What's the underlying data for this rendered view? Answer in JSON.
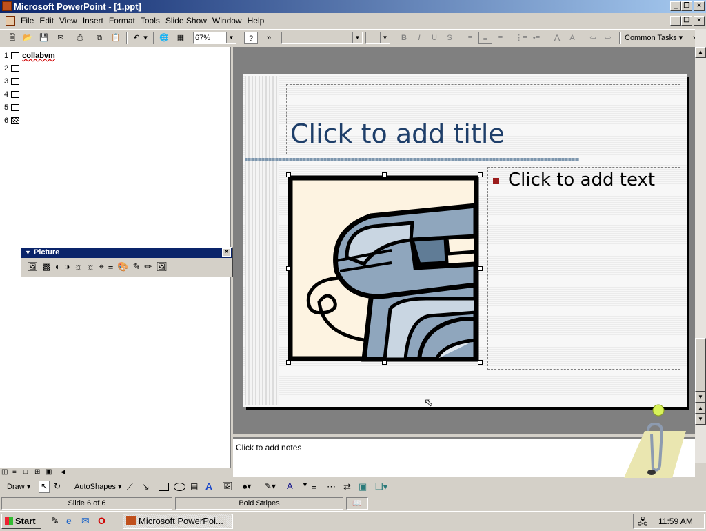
{
  "window": {
    "title": "Microsoft PowerPoint - [1.ppt]"
  },
  "menu": [
    "File",
    "Edit",
    "View",
    "Insert",
    "Format",
    "Tools",
    "Slide Show",
    "Window",
    "Help"
  ],
  "toolbar": {
    "zoom": "67%",
    "common_tasks": "Common Tasks ▾",
    "font_name": "",
    "font_size": ""
  },
  "outline": {
    "slides": [
      {
        "num": "1",
        "text": "collabvm"
      },
      {
        "num": "2",
        "text": ""
      },
      {
        "num": "3",
        "text": ""
      },
      {
        "num": "4",
        "text": ""
      },
      {
        "num": "5",
        "text": ""
      },
      {
        "num": "6",
        "text": ""
      }
    ]
  },
  "picture_toolbar": {
    "title": "Picture"
  },
  "slide": {
    "title_placeholder": "Click to add title",
    "text_placeholder": "Click to add text",
    "accent_color": "#9b1c1c",
    "title_color": "#1f3f6a"
  },
  "notes": {
    "placeholder": "Click to add notes"
  },
  "drawing": {
    "draw_label": "Draw ▾",
    "autoshapes_label": "AutoShapes ▾"
  },
  "status": {
    "slide": "Slide 6 of 6",
    "design": "Bold Stripes"
  },
  "taskbar": {
    "start": "Start",
    "task": "Microsoft PowerPoi...",
    "clock": "11:59 AM"
  }
}
